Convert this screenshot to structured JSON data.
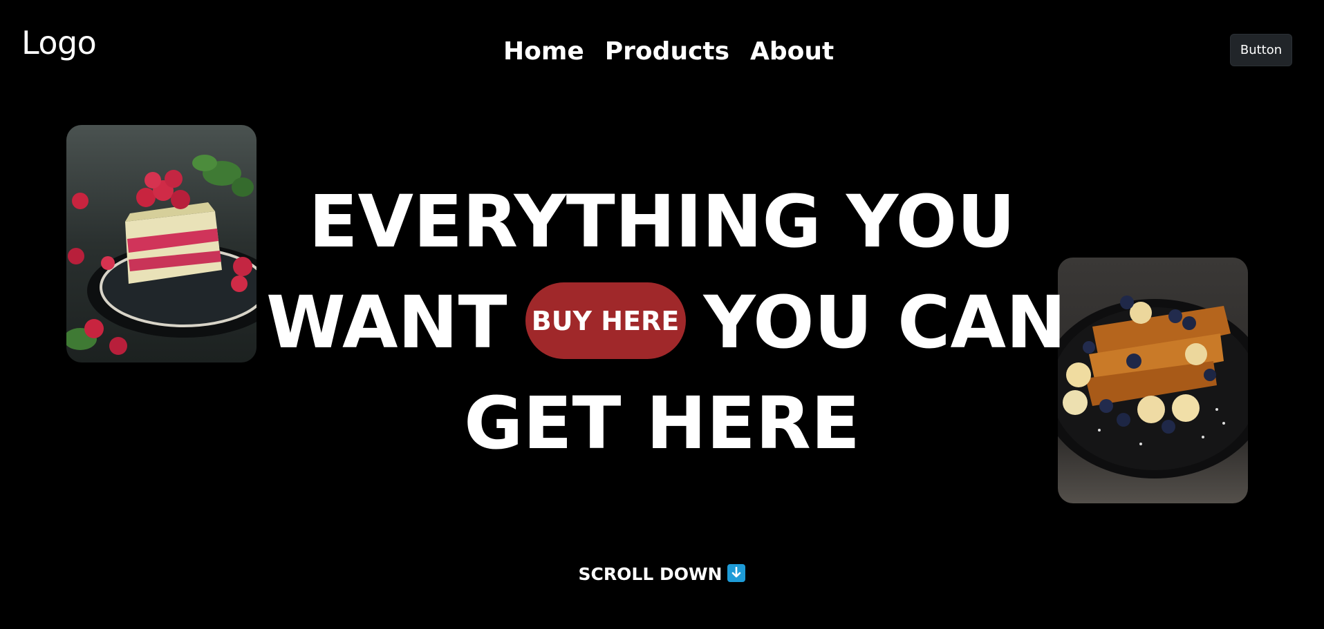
{
  "header": {
    "logo": "Logo",
    "nav": [
      {
        "label": "Home"
      },
      {
        "label": "Products"
      },
      {
        "label": "About"
      }
    ],
    "button_label": "Button"
  },
  "hero": {
    "line1": "EVERYTHING YOU",
    "line2_start": "WANT",
    "buy_label": "BUY HERE",
    "line2_end": "YOU CAN",
    "line3": "GET HERE"
  },
  "images": {
    "left": "cake-image",
    "right": "french-toast-image"
  },
  "scroll": {
    "label": "SCROLL DOWN",
    "icon": "down-arrow-icon"
  },
  "colors": {
    "background": "#000000",
    "accent": "#a0282a",
    "button_bg": "#212529",
    "arrow_icon_bg": "#1e9bd7"
  }
}
